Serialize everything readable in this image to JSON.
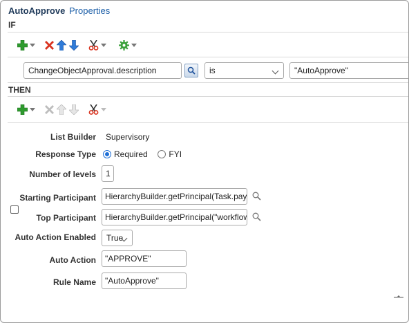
{
  "tabs": {
    "active": "AutoApprove",
    "properties": "Properties"
  },
  "sections": {
    "if_label": "IF",
    "then_label": "THEN"
  },
  "icons": {
    "add": "plus-icon",
    "delete": "delete-x-icon",
    "move_up": "arrow-up-icon",
    "move_down": "arrow-down-icon",
    "cut": "scissors-icon",
    "settings": "gear-icon",
    "search": "search-icon"
  },
  "condition": {
    "left_operand": "ChangeObjectApproval.description",
    "operator": "is",
    "right_operand": "\"AutoApprove\""
  },
  "action": {
    "list_builder_label": "List Builder",
    "list_builder_value": "Supervisory",
    "response_type_label": "Response Type",
    "response_required": "Required",
    "response_fyi": "FYI",
    "number_of_levels_label": "Number of levels",
    "number_of_levels_value": "1",
    "starting_participant_label": "Starting Participant",
    "starting_participant_value": "HierarchyBuilder.getPrincipal(Task.payload.C",
    "top_participant_label": "Top Participant",
    "top_participant_value": "HierarchyBuilder.getPrincipal(\"workflowsyste",
    "auto_action_enabled_label": "Auto Action Enabled",
    "auto_action_enabled_value": "True",
    "auto_action_label": "Auto Action",
    "auto_action_value": "\"APPROVE\"",
    "rule_name_label": "Rule Name",
    "rule_name_value": "\"AutoApprove\""
  },
  "colors": {
    "title": "#1f3a5a",
    "link": "#1d5fa8",
    "green_add": "#2e9b2e",
    "red_delete": "#d9331f",
    "blue_arrow": "#2f7bd8"
  }
}
